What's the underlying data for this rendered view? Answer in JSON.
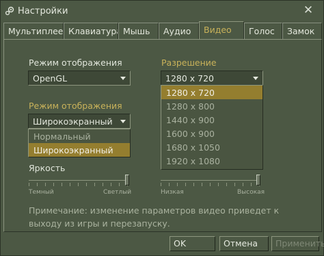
{
  "window": {
    "title": "Настройки",
    "close_glyph": "✕"
  },
  "tabs": [
    {
      "label": "Мультиплеер",
      "active": false
    },
    {
      "label": "Клавиатура",
      "active": false
    },
    {
      "label": "Мышь",
      "active": false
    },
    {
      "label": "Аудио",
      "active": false
    },
    {
      "label": "Видео",
      "active": true
    },
    {
      "label": "Голос",
      "active": false
    },
    {
      "label": "Замок",
      "active": false
    }
  ],
  "video": {
    "display_mode_label": "Режим отображения",
    "display_mode_value": "OpenGL",
    "resolution_label": "Разрешение",
    "resolution_value": "1280 x 720",
    "resolution_options": [
      "1280 x 720",
      "1280 x 800",
      "1440 x 900",
      "1600 x 900",
      "1680 x 1050",
      "1920 x 1080"
    ],
    "resolution_selected_index": 0,
    "aspect_label": "Режим отображения",
    "aspect_value": "Широкоэкранный",
    "aspect_options": [
      "Нормальный",
      "Широкоэкранный"
    ],
    "aspect_selected_index": 1,
    "brightness_label": "Яркость",
    "brightness_min_label": "Темный",
    "brightness_max_label": "Светлый",
    "brightness_level": 1.0,
    "right_slider_min_label": "Низкая",
    "right_slider_max_label": "Высокая",
    "right_slider_level": 1.0,
    "note": "Примечание: изменение параметров видео приведет к выходу из игры и перезапуску."
  },
  "buttons": {
    "ok": "OK",
    "cancel": "Отмена",
    "apply": "Применить"
  },
  "colors": {
    "background": "#4c5844",
    "accent": "#c9b25a",
    "selection": "#947e2f"
  }
}
